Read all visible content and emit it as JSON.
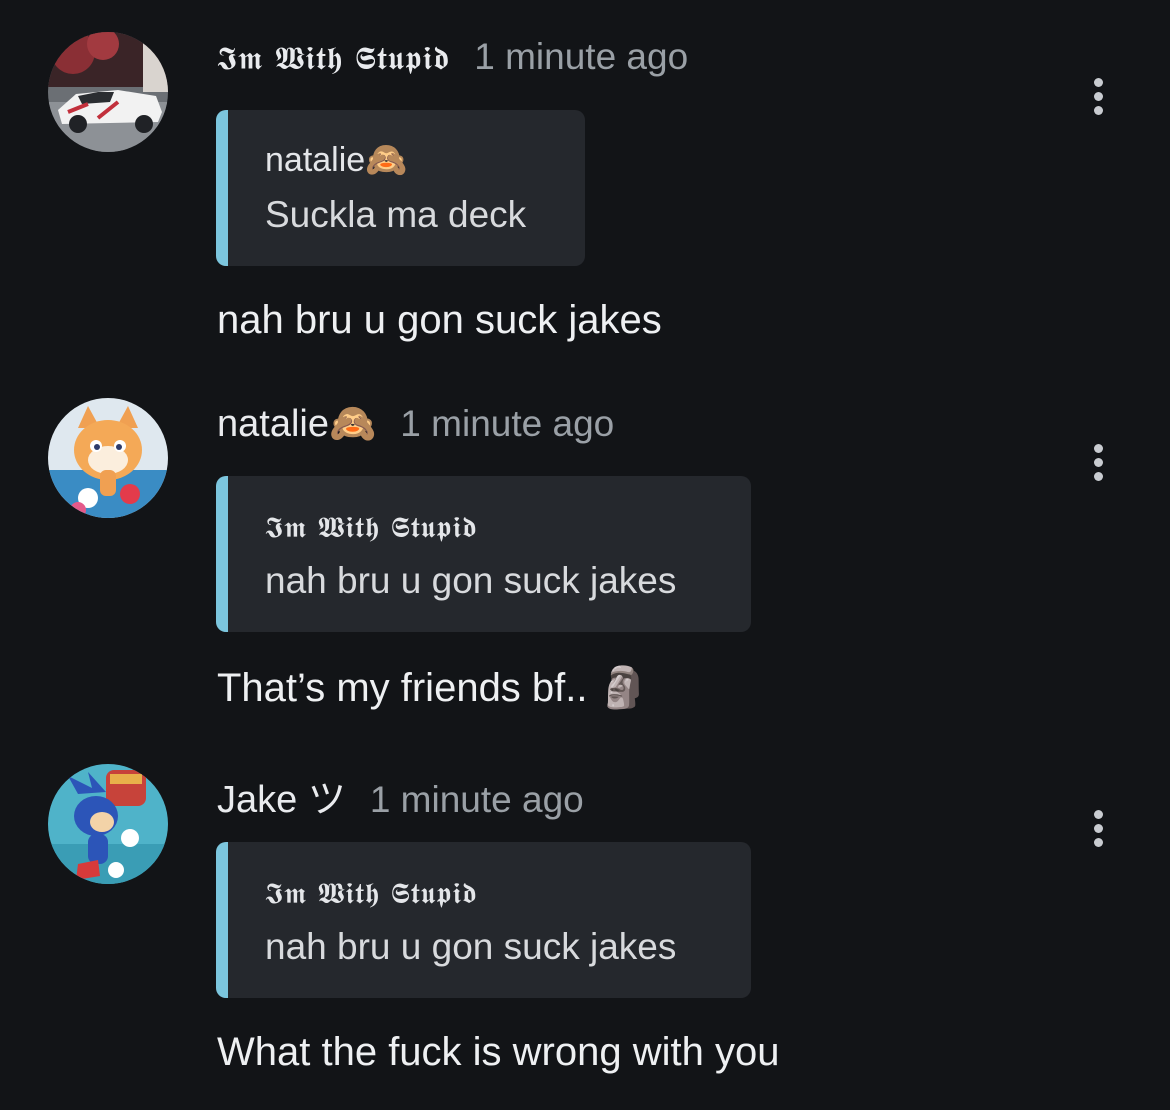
{
  "comments": [
    {
      "author": "𝕴𝖒 𝖂𝖎𝖙𝖍 𝕾𝖙𝖚𝖕𝖎𝖉",
      "time": "1 minute ago",
      "quote": {
        "author": "natalie🙈",
        "text": "Suckla ma deck"
      },
      "body": "nah bru u gon suck jakes",
      "avatar_icon": "car-avatar-icon"
    },
    {
      "author": "natalie🙈",
      "time": "1 minute ago",
      "quote": {
        "author": "𝕴𝖒 𝖂𝖎𝖙𝖍 𝕾𝖙𝖚𝖕𝖎𝖉",
        "text": "nah bru u gon suck jakes"
      },
      "body": "That’s my friends bf.. 🗿",
      "avatar_icon": "fox-avatar-icon"
    },
    {
      "author": "Jake ツ",
      "time": "1 minute ago",
      "quote": {
        "author": "𝕴𝖒 𝖂𝖎𝖙𝖍 𝕾𝖙𝖚𝖕𝖎𝖉",
        "text": "nah bru u gon suck jakes"
      },
      "body": "What the fuck is wrong with you",
      "avatar_icon": "hedgehog-avatar-icon"
    }
  ],
  "colors": {
    "background": "#121417",
    "quote_background": "#25282d",
    "quote_accent": "#7cc6de",
    "timestamp": "#9aa0a6"
  }
}
